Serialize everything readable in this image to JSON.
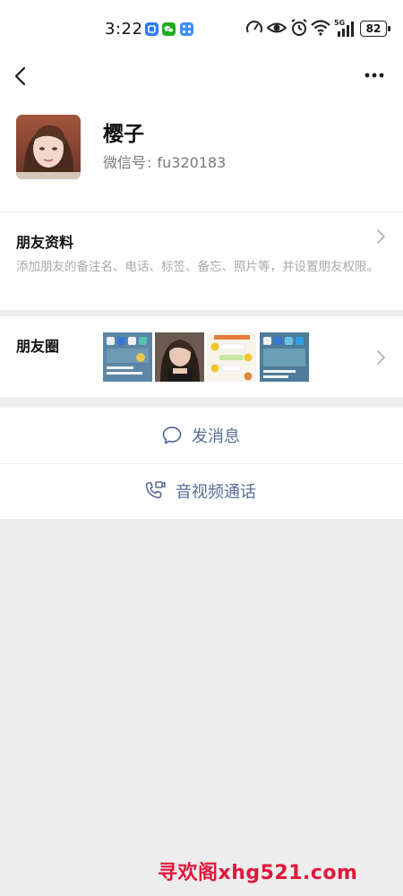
{
  "status_bar": {
    "time": "3:22",
    "network": "5G",
    "battery": "82",
    "notification_icons": [
      "app-blue-icon",
      "wechat-green-icon",
      "app-grid-icon"
    ],
    "system_icons": [
      "speedometer-icon",
      "eye-icon",
      "alarm-icon",
      "wifi-icon",
      "signal-icon",
      "battery-icon"
    ]
  },
  "header": {
    "back_icon": "chevron-left-icon",
    "more_icon": "more-dots-icon"
  },
  "profile": {
    "nickname": "樱子",
    "wechat_id_label": "微信号",
    "wechat_id_sep": ":",
    "wechat_id_value": "fu320183"
  },
  "friend_info": {
    "title": "朋友资料",
    "description": "添加朋友的备注名、电话、标签、备忘、照片等，并设置朋友权限。"
  },
  "moments": {
    "title": "朋友圈",
    "thumbnails": [
      "screenshot-phone-1",
      "selfie-photo",
      "chat-screenshot",
      "screenshot-phone-2"
    ]
  },
  "actions": {
    "send_message": "发消息",
    "av_call": "音视频通话"
  },
  "colors": {
    "link_blue": "#576b95",
    "background": "#ededed",
    "watermark_red": "#e0173a"
  },
  "watermark": {
    "text": "寻欢阁xhg521.com"
  }
}
